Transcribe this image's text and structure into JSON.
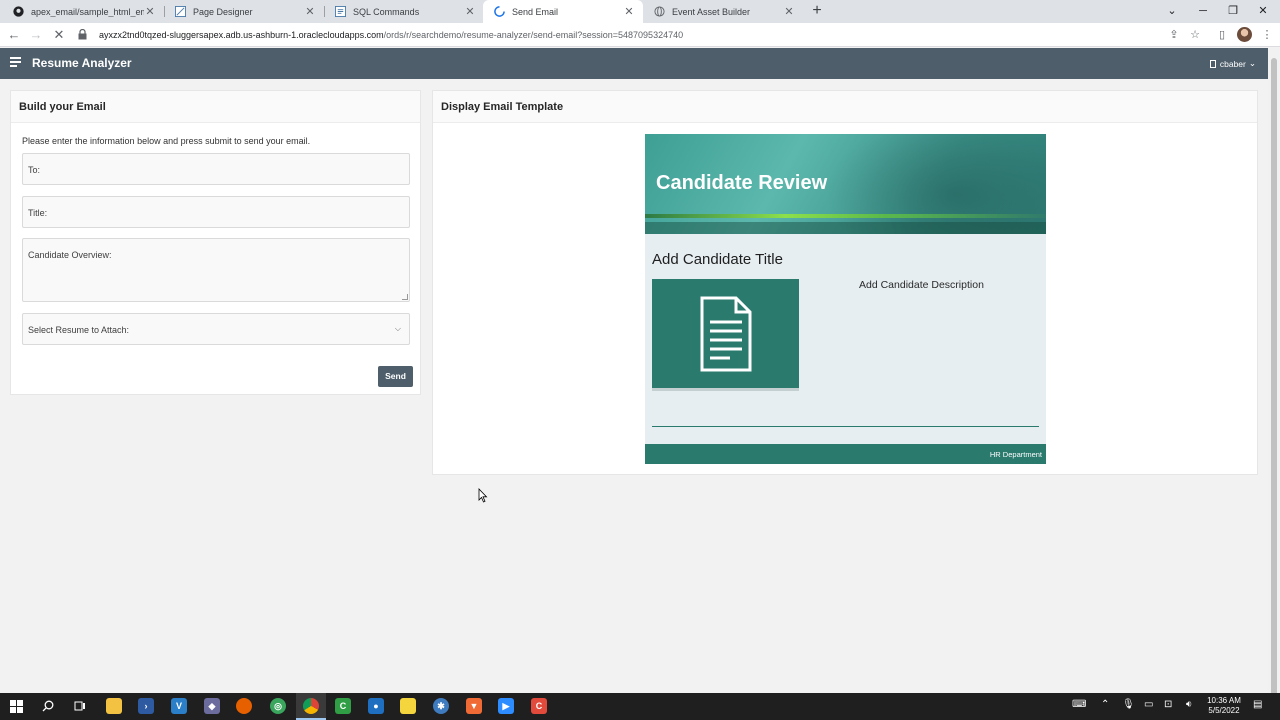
{
  "browser": {
    "tabs": [
      {
        "title": "apex_email/sample_html_email.h",
        "icon": "github-icon"
      },
      {
        "title": "Page Designer",
        "icon": "page-designer-icon"
      },
      {
        "title": "SQL Commands",
        "icon": "sql-icon"
      },
      {
        "title": "Send Email",
        "icon": "loading-icon",
        "active": true
      },
      {
        "title": "Event Asset Builder",
        "icon": "globe-icon"
      }
    ],
    "url_host": "ayxzx2tnd0tqzed-sluggersapex.adb.us-ashburn-1.oraclecloudapps.com",
    "url_path": "/ords/r/searchdemo/resume-analyzer/send-email?session=5487095324740"
  },
  "app": {
    "title": "Resume Analyzer",
    "user": "cbaber"
  },
  "build_region": {
    "heading": "Build your Email",
    "instructions": "Please enter the information below and press submit to send your email.",
    "to_label": "To:",
    "title_label": "Title:",
    "overview_label": "Candidate Overview:",
    "resume_label": "Select Resume to Attach:",
    "send_label": "Send"
  },
  "template_region": {
    "heading": "Display Email Template",
    "banner_title": "Candidate Review",
    "candidate_title": "Add Candidate Title",
    "candidate_description": "Add Candidate Description",
    "footer": "HR Department"
  },
  "taskbar": {
    "time": "10:36 AM",
    "date": "5/5/2022"
  },
  "colors": {
    "header": "#4e5f6b",
    "teal": "#2a7a6e",
    "banner": "#5cb8ad"
  }
}
